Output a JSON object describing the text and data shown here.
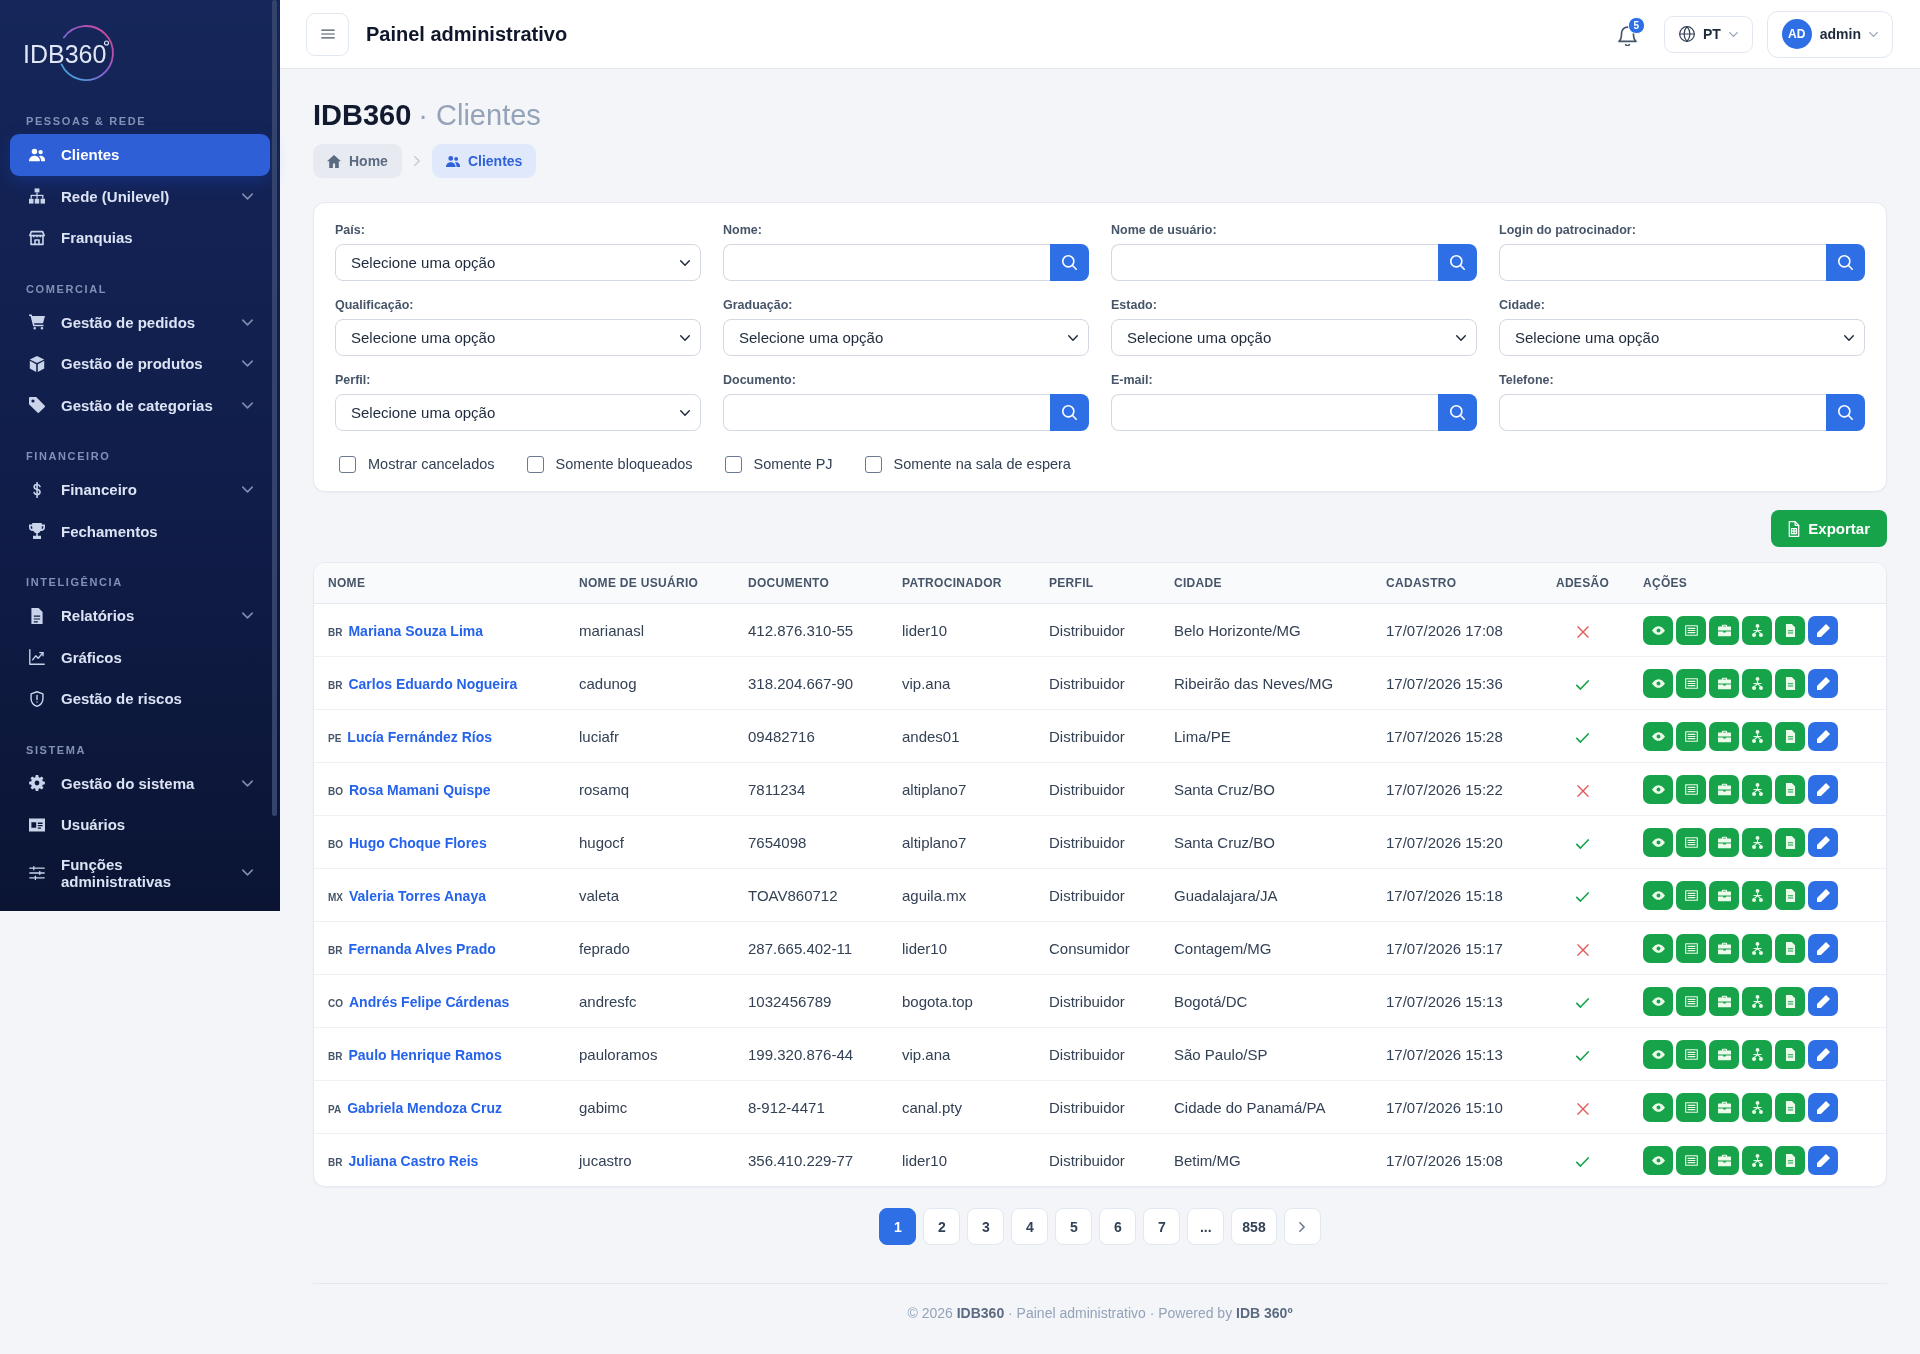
{
  "sidebar": {
    "logo": "IDB360",
    "sections": [
      {
        "title": "PESSOAS & REDE",
        "items": [
          {
            "label": "Clientes",
            "selected": true,
            "has_submenu": false
          },
          {
            "label": "Rede (Unilevel)",
            "selected": false,
            "has_submenu": true
          },
          {
            "label": "Franquias",
            "selected": false,
            "has_submenu": false
          }
        ]
      },
      {
        "title": "COMERCIAL",
        "items": [
          {
            "label": "Gestão de pedidos",
            "selected": false,
            "has_submenu": true
          },
          {
            "label": "Gestão de produtos",
            "selected": false,
            "has_submenu": true
          },
          {
            "label": "Gestão de categorias",
            "selected": false,
            "has_submenu": true
          }
        ]
      },
      {
        "title": "FINANCEIRO",
        "items": [
          {
            "label": "Financeiro",
            "selected": false,
            "has_submenu": true
          },
          {
            "label": "Fechamentos",
            "selected": false,
            "has_submenu": false
          }
        ]
      },
      {
        "title": "INTELIGÊNCIA",
        "items": [
          {
            "label": "Relatórios",
            "selected": false,
            "has_submenu": true
          },
          {
            "label": "Gráficos",
            "selected": false,
            "has_submenu": false
          },
          {
            "label": "Gestão de riscos",
            "selected": false,
            "has_submenu": false
          }
        ]
      },
      {
        "title": "SISTEMA",
        "items": [
          {
            "label": "Gestão do sistema",
            "selected": false,
            "has_submenu": true
          },
          {
            "label": "Usuários",
            "selected": false,
            "has_submenu": false
          },
          {
            "label": "Funções administrativas",
            "selected": false,
            "has_submenu": true
          }
        ]
      }
    ]
  },
  "header": {
    "title": "Painel administrativo",
    "notifications": "5",
    "language": "PT",
    "user": {
      "initials": "AD",
      "name": "admin"
    }
  },
  "page": {
    "brand": "IDB360",
    "title": "· Clientes"
  },
  "breadcrumb": [
    {
      "label": "Home",
      "selected": false
    },
    {
      "label": "Clientes",
      "selected": true
    }
  ],
  "filters": {
    "fields": [
      {
        "label": "País:",
        "kind": "select",
        "value": "Selecione uma opção"
      },
      {
        "label": "Nome:",
        "kind": "search"
      },
      {
        "label": "Nome de usuário:",
        "kind": "search"
      },
      {
        "label": "Login do patrocinador:",
        "kind": "search"
      },
      {
        "label": "Qualificação:",
        "kind": "select",
        "value": "Selecione uma opção"
      },
      {
        "label": "Graduação:",
        "kind": "select",
        "value": "Selecione uma opção"
      },
      {
        "label": "Estado:",
        "kind": "select",
        "value": "Selecione uma opção"
      },
      {
        "label": "Cidade:",
        "kind": "select",
        "value": "Selecione uma opção"
      },
      {
        "label": "Perfil:",
        "kind": "select",
        "value": "Selecione uma opção"
      },
      {
        "label": "Documento:",
        "kind": "search"
      },
      {
        "label": "E-mail:",
        "kind": "search"
      },
      {
        "label": "Telefone:",
        "kind": "search"
      }
    ],
    "checkboxes": [
      {
        "label": "Mostrar cancelados",
        "checked": false
      },
      {
        "label": "Somente bloqueados",
        "checked": false
      },
      {
        "label": "Somente PJ",
        "checked": false
      },
      {
        "label": "Somente na sala de espera",
        "checked": false
      }
    ]
  },
  "export_button": "Exportar",
  "table": {
    "columns": [
      "NOME",
      "NOME DE USUÁRIO",
      "DOCUMENTO",
      "PATROCINADOR",
      "PERFIL",
      "CIDADE",
      "CADASTRO",
      "ADESÃO",
      "AÇÕES"
    ],
    "rows": [
      {
        "country": "BR",
        "name": "Mariana Souza Lima",
        "username": "marianasl",
        "document": "412.876.310-55",
        "sponsor": "lider10",
        "profile": "Distribuidor",
        "city": "Belo Horizonte/MG",
        "registered": "17/07/2026 17:08",
        "adesao": false
      },
      {
        "country": "BR",
        "name": "Carlos Eduardo Nogueira",
        "username": "cadunog",
        "document": "318.204.667-90",
        "sponsor": "vip.ana",
        "profile": "Distribuidor",
        "city": "Ribeirão das Neves/MG",
        "registered": "17/07/2026 15:36",
        "adesao": true
      },
      {
        "country": "PE",
        "name": "Lucía Fernández Ríos",
        "username": "luciafr",
        "document": "09482716",
        "sponsor": "andes01",
        "profile": "Distribuidor",
        "city": "Lima/PE",
        "registered": "17/07/2026 15:28",
        "adesao": true
      },
      {
        "country": "BO",
        "name": "Rosa Mamani Quispe",
        "username": "rosamq",
        "document": "7811234",
        "sponsor": "altiplano7",
        "profile": "Distribuidor",
        "city": "Santa Cruz/BO",
        "registered": "17/07/2026 15:22",
        "adesao": false
      },
      {
        "country": "BO",
        "name": "Hugo Choque Flores",
        "username": "hugocf",
        "document": "7654098",
        "sponsor": "altiplano7",
        "profile": "Distribuidor",
        "city": "Santa Cruz/BO",
        "registered": "17/07/2026 15:20",
        "adesao": true
      },
      {
        "country": "MX",
        "name": "Valeria Torres Anaya",
        "username": "valeta",
        "document": "TOAV860712",
        "sponsor": "aguila.mx",
        "profile": "Distribuidor",
        "city": "Guadalajara/JA",
        "registered": "17/07/2026 15:18",
        "adesao": true
      },
      {
        "country": "BR",
        "name": "Fernanda Alves Prado",
        "username": "feprado",
        "document": "287.665.402-11",
        "sponsor": "lider10",
        "profile": "Consumidor",
        "city": "Contagem/MG",
        "registered": "17/07/2026 15:17",
        "adesao": false
      },
      {
        "country": "CO",
        "name": "Andrés Felipe Cárdenas",
        "username": "andresfc",
        "document": "1032456789",
        "sponsor": "bogota.top",
        "profile": "Distribuidor",
        "city": "Bogotá/DC",
        "registered": "17/07/2026 15:13",
        "adesao": true
      },
      {
        "country": "BR",
        "name": "Paulo Henrique Ramos",
        "username": "pauloramos",
        "document": "199.320.876-44",
        "sponsor": "vip.ana",
        "profile": "Distribuidor",
        "city": "São Paulo/SP",
        "registered": "17/07/2026 15:13",
        "adesao": true
      },
      {
        "country": "PA",
        "name": "Gabriela Mendoza Cruz",
        "username": "gabimc",
        "document": "8-912-4471",
        "sponsor": "canal.pty",
        "profile": "Distribuidor",
        "city": "Cidade do Panamá/PA",
        "registered": "17/07/2026 15:10",
        "adesao": false
      },
      {
        "country": "BR",
        "name": "Juliana Castro Reis",
        "username": "jucastro",
        "document": "356.410.229-77",
        "sponsor": "lider10",
        "profile": "Distribuidor",
        "city": "Betim/MG",
        "registered": "17/07/2026 15:08",
        "adesao": true
      }
    ]
  },
  "pagination": {
    "pages": [
      {
        "label": "1",
        "selected": true
      },
      {
        "label": "2",
        "selected": false
      },
      {
        "label": "3",
        "selected": false
      },
      {
        "label": "4",
        "selected": false
      },
      {
        "label": "5",
        "selected": false
      },
      {
        "label": "6",
        "selected": false
      },
      {
        "label": "7",
        "selected": false
      },
      {
        "label": "...",
        "selected": false
      },
      {
        "label": "858",
        "selected": false
      }
    ]
  },
  "footer": "© 2026 **IDB360** · Painel administrativo · Powered by **IDB 360º**"
}
